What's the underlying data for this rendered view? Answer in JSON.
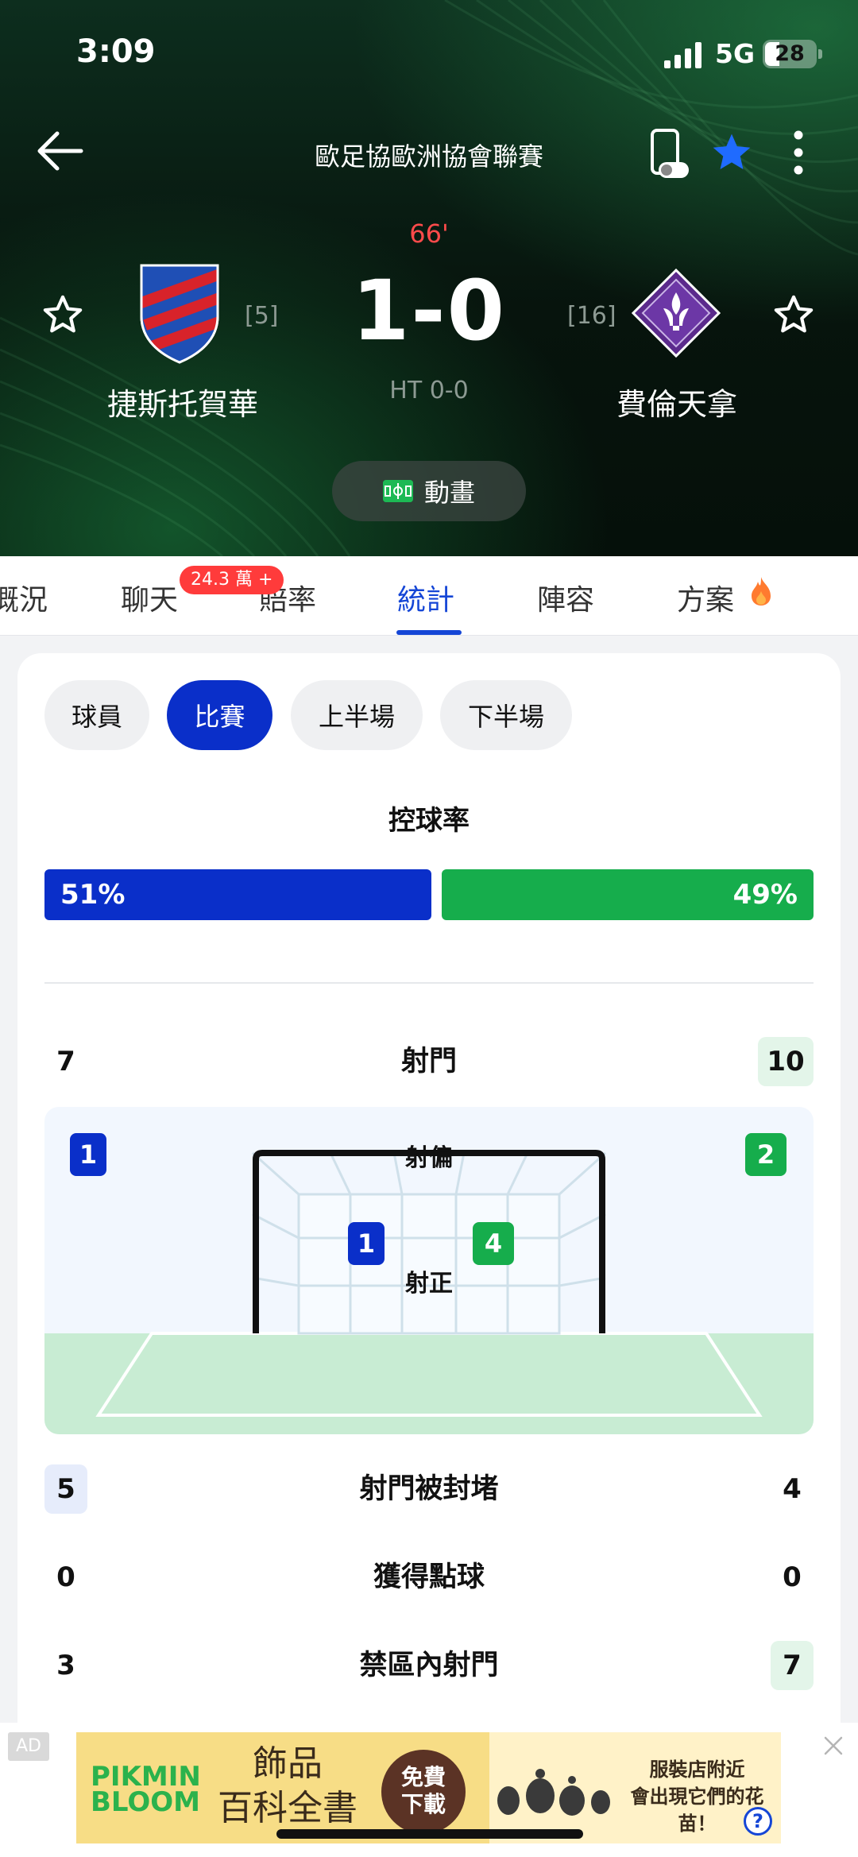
{
  "status_bar": {
    "time": "3:09",
    "network": "5G",
    "battery": "28"
  },
  "header": {
    "league": "歐足協歐洲協會聯賽",
    "minute": "66'",
    "score": "1-0",
    "halftime": "HT 0-0",
    "home": {
      "name": "捷斯托賀華",
      "rank": "[5]"
    },
    "away": {
      "name": "費倫天拿",
      "rank": "[16]"
    },
    "animation_label": "動畫"
  },
  "tabs": {
    "items": [
      "概況",
      "聊天",
      "賠率",
      "統計",
      "陣容",
      "方案"
    ],
    "active": "統計",
    "chat_badge": "24.3 萬 +"
  },
  "filters": {
    "items": [
      "球員",
      "比賽",
      "上半場",
      "下半場"
    ],
    "active": "比賽"
  },
  "possession": {
    "title": "控球率",
    "home": "51%",
    "away": "49%"
  },
  "stats": {
    "shots": {
      "label": "射門",
      "home": "7",
      "away": "10"
    },
    "shots_off": {
      "label": "射偏",
      "home": "1",
      "away": "2"
    },
    "shots_on": {
      "label": "射正",
      "home": "1",
      "away": "4"
    },
    "blocked": {
      "label": "射門被封堵",
      "home": "5",
      "away": "4"
    },
    "penalties": {
      "label": "獲得點球",
      "home": "0",
      "away": "0"
    },
    "box_shots": {
      "label": "禁區內射門",
      "home": "3",
      "away": "7"
    }
  },
  "ad": {
    "tag": "AD",
    "brand_line1": "PIKMIN",
    "brand_line2": "BLOOM",
    "headline_line1": "飾品",
    "headline_line2": "百科全書",
    "cta_line1": "免費",
    "cta_line2": "下載",
    "sub_line1": "服裝店附近",
    "sub_line2": "會出現它們的花苗！",
    "help": "?"
  },
  "colors": {
    "home": "#0a2fc9",
    "away": "#16ad4c",
    "accent": "#1546d6",
    "live": "#ff4b4b"
  }
}
